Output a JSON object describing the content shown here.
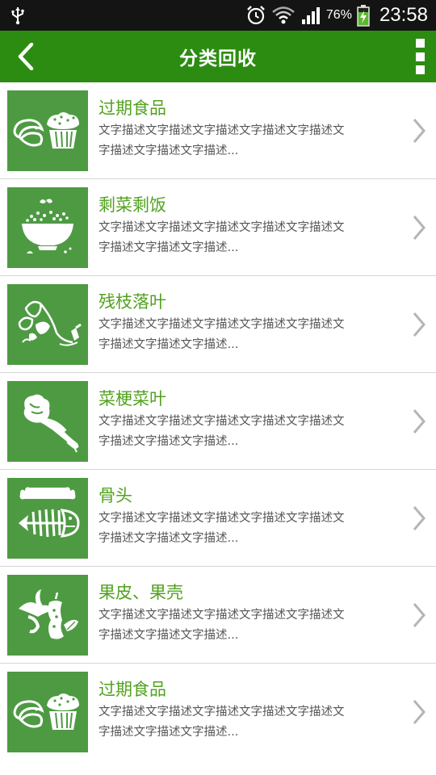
{
  "status_bar": {
    "battery": "76%",
    "time": "23:58",
    "icons": [
      "usb-icon",
      "alarm-icon",
      "wifi-icon",
      "signal-icon",
      "battery-charging-icon"
    ]
  },
  "header": {
    "title": "分类回收",
    "back_icon": "back-chevron-icon",
    "menu_icon": "overflow-menu-icon"
  },
  "colors": {
    "header_bg": "#2c8c12",
    "thumb_bg": "#4e9a43",
    "title_text": "#52a21f",
    "status_bg": "#141414"
  },
  "items": [
    {
      "title": "过期食品",
      "desc_line1": "文字描述文字描述文字描述文字描述文字描述文",
      "desc_line2": "字描述文字描述文字描述...",
      "icon": "expired-food-icon"
    },
    {
      "title": "剩菜剩饭",
      "desc_line1": "文字描述文字描述文字描述文字描述文字描述文",
      "desc_line2": "字描述文字描述文字描述...",
      "icon": "leftover-rice-bowl-icon"
    },
    {
      "title": "残枝落叶",
      "desc_line1": "文字描述文字描述文字描述文字描述文字描述文",
      "desc_line2": "字描述文字描述文字描述...",
      "icon": "fallen-leaves-icon"
    },
    {
      "title": "菜梗菜叶",
      "desc_line1": "文字描述文字描述文字描述文字描述文字描述文",
      "desc_line2": "字描述文字描述文字描述...",
      "icon": "vegetable-icon"
    },
    {
      "title": "骨头",
      "desc_line1": "文字描述文字描述文字描述文字描述文字描述文",
      "desc_line2": "字描述文字描述文字描述...",
      "icon": "bone-fishbone-icon"
    },
    {
      "title": "果皮、果壳",
      "desc_line1": "文字描述文字描述文字描述文字描述文字描述文",
      "desc_line2": "字描述文字描述文字描述...",
      "icon": "fruit-peel-icon"
    },
    {
      "title": "过期食品",
      "desc_line1": "文字描述文字描述文字描述文字描述文字描述文",
      "desc_line2": "字描述文字描述文字描述...",
      "icon": "expired-food-icon"
    }
  ]
}
